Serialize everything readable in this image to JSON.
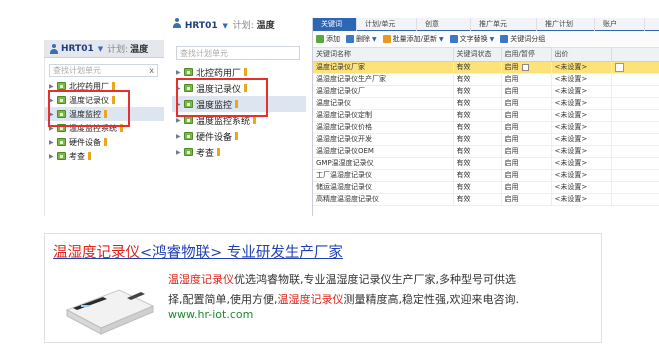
{
  "header": {
    "user": "HRT01",
    "plan_label": "计划:",
    "plan_value": "温度"
  },
  "panel_small": {
    "search_placeholder": "查找计划单元",
    "search_clear": "x",
    "items": [
      {
        "label": "北控药用厂",
        "selected": false
      },
      {
        "label": "温度记录仪",
        "selected": false
      },
      {
        "label": "温度监控",
        "selected": true
      },
      {
        "label": "温度监控系统",
        "selected": false
      },
      {
        "label": "硬件设备",
        "selected": false
      },
      {
        "label": "考查",
        "selected": false
      }
    ]
  },
  "panel_medium": {
    "search_placeholder": "查找计划单元",
    "items": [
      {
        "label": "北控药用厂",
        "selected": false
      },
      {
        "label": "温度记录仪",
        "selected": false
      },
      {
        "label": "温度监控",
        "selected": true
      },
      {
        "label": "温度监控系统",
        "selected": false
      },
      {
        "label": "硬件设备",
        "selected": false
      },
      {
        "label": "考查",
        "selected": false
      }
    ]
  },
  "grid": {
    "tabs": [
      "关键词",
      "计划/单元",
      "创意",
      "推广单元",
      "推广计划",
      "账户"
    ],
    "toolbar": {
      "add": "添加",
      "delete": "删除",
      "bulk": "批量添加/更新",
      "text": "文字替换",
      "recommend": "关键词分组"
    },
    "columns": [
      "关键词名称",
      "关键词状态",
      "启用/暂停",
      "出价"
    ],
    "rows": [
      {
        "keyword": "温度记录仪厂家",
        "status": "有效",
        "enabled": "启用",
        "bid": "<未设置>",
        "highlight": true
      },
      {
        "keyword": "温湿度记录仪生产厂家",
        "status": "有效",
        "enabled": "启用",
        "bid": "<未设置>",
        "highlight": false
      },
      {
        "keyword": "温湿度记录仪厂",
        "status": "有效",
        "enabled": "启用",
        "bid": "<未设置>",
        "highlight": false
      },
      {
        "keyword": "温度记录仪",
        "status": "有效",
        "enabled": "启用",
        "bid": "<未设置>",
        "highlight": false
      },
      {
        "keyword": "温湿度记录仪定制",
        "status": "有效",
        "enabled": "启用",
        "bid": "<未设置>",
        "highlight": false
      },
      {
        "keyword": "温湿度记录仪价格",
        "status": "有效",
        "enabled": "启用",
        "bid": "<未设置>",
        "highlight": false
      },
      {
        "keyword": "温湿度记录仪开发",
        "status": "有效",
        "enabled": "启用",
        "bid": "<未设置>",
        "highlight": false
      },
      {
        "keyword": "温湿度记录仪OEM",
        "status": "有效",
        "enabled": "启用",
        "bid": "<未设置>",
        "highlight": false
      },
      {
        "keyword": "GMP温湿度记录仪",
        "status": "有效",
        "enabled": "启用",
        "bid": "<未设置>",
        "highlight": false
      },
      {
        "keyword": "工厂温湿度记录仪",
        "status": "有效",
        "enabled": "启用",
        "bid": "<未设置>",
        "highlight": false
      },
      {
        "keyword": "储运温湿度记录仪",
        "status": "有效",
        "enabled": "启用",
        "bid": "<未设置>",
        "highlight": false
      },
      {
        "keyword": "高精度温湿度记录仪",
        "status": "有效",
        "enabled": "启用",
        "bid": "<未设置>",
        "highlight": false
      }
    ]
  },
  "ad": {
    "title_red": "温湿度记录仪",
    "title_blue": "<鸿睿物联> 专业研发生产厂家",
    "line1_red": "温湿度记录仪",
    "line1_rest": "优选鸿睿物联,专业温湿度记录仪生产厂家,多种型号可供选",
    "line2_start": "择,配置简单,使用方便,",
    "line2_red": "温湿度记录仪",
    "line2_rest": "测量精度高,稳定性强,欢迎来电咨询.",
    "url": "www.hr-iot.com"
  },
  "colors": {
    "highlight_box": "#e53030",
    "selected_row": "#fde27a",
    "accent_blue": "#2f66b3",
    "ad_red": "#e0241b",
    "ad_blue": "#2140b4",
    "ad_green": "#1a8a2a"
  }
}
